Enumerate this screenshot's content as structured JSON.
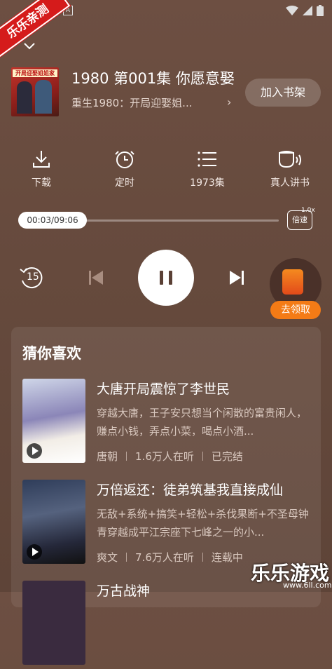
{
  "watermark": {
    "ribbon": "乐乐亲测",
    "logo": "乐乐游戏",
    "url": "www.6ll.com"
  },
  "book": {
    "cover_banner": "开局迎娶姐姐家",
    "title": "1980 第001集 你愿意娶",
    "subtitle": "重生1980：开局迎娶姐...",
    "shelf_button": "加入书架"
  },
  "actions": [
    {
      "label": "下载",
      "icon": "download-icon"
    },
    {
      "label": "定时",
      "icon": "timer-icon"
    },
    {
      "label": "1973集",
      "icon": "playlist-icon"
    },
    {
      "label": "真人讲书",
      "icon": "narrator-icon"
    }
  ],
  "player": {
    "time": "00:03/09:06",
    "progress": 0.005,
    "speed_value": "1.0x",
    "speed_label": "倍速",
    "rewind_seconds": "15",
    "reward_label": "去领取"
  },
  "recommend": {
    "title": "猜你喜欢",
    "items": [
      {
        "title": "大唐开局震惊了李世民",
        "desc": "穿越大唐，王子安只想当个闲散的富贵闲人，赚点小钱，弄点小菜，喝点小酒...",
        "author": "唐朝",
        "listeners": "1.6万人在听",
        "status": "已完结"
      },
      {
        "title": "万倍返还：徒弟筑基我直接成仙",
        "desc": "无敌+系统+搞笑+轻松+杀伐果断+不圣母钟青穿越成平江宗座下七峰之一的小...",
        "author": "爽文",
        "listeners": "7.6万人在听",
        "status": "连载中"
      },
      {
        "title": "万古战神"
      }
    ]
  },
  "colors": {
    "background": "#6b4d40",
    "accent": "#f47b16"
  }
}
